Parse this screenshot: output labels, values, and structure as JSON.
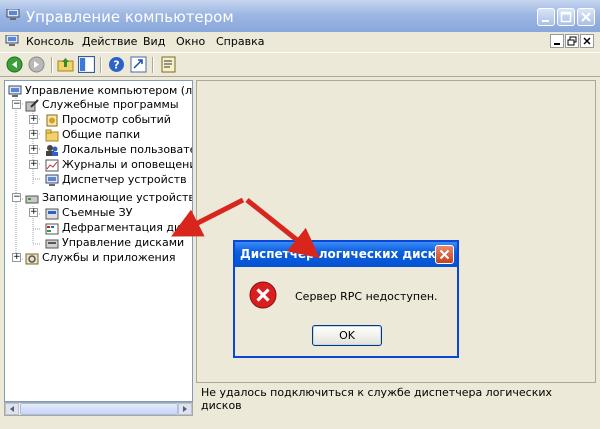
{
  "window": {
    "title": "Управление компьютером"
  },
  "menu": {
    "items": [
      "Консоль",
      "Действие",
      "Вид",
      "Окно",
      "Справка"
    ]
  },
  "toolbar": {
    "icons": [
      "back-icon",
      "forward-icon",
      "up-folder-icon",
      "show-hide-tree-icon",
      "help-icon",
      "export-icon",
      "properties-icon"
    ]
  },
  "tree": {
    "root": "Управление компьютером (локаль",
    "system_tools": "Служебные программы",
    "event_viewer": "Просмотр событий",
    "shared_folders": "Общие папки",
    "local_users": "Локальные пользователи",
    "perf_logs": "Журналы и оповещения п",
    "device_manager": "Диспетчер устройств",
    "storage": "Запоминающие устройства",
    "removable": "Съемные ЗУ",
    "defrag": "Дефрагментация диска",
    "disk_mgmt": "Управление дисками",
    "services_apps": "Службы и приложения"
  },
  "status": {
    "text": "Не удалось подключиться к службе диспетчера логических дисков"
  },
  "dialog": {
    "title": "Диспетчер логических дисков",
    "message": "Сервер RPC недоступен.",
    "ok_label": "OK"
  },
  "colors": {
    "annotation_arrow": "#d8261c",
    "dialog_title": "#0a5ee0",
    "titlebar": "#9db7e3"
  }
}
